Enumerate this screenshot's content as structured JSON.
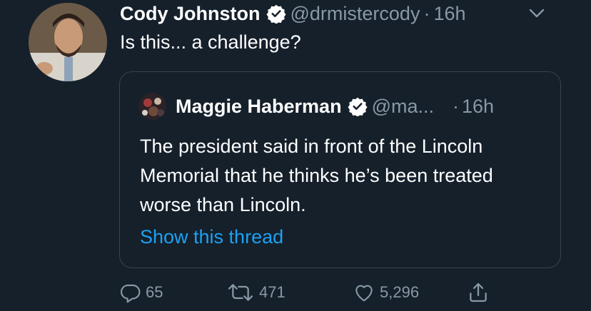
{
  "tweet": {
    "author_name": "Cody Johnston",
    "handle": "@drmistercody",
    "separator": "·",
    "time": "16h",
    "text": "Is this... a challenge?"
  },
  "quoted_tweet": {
    "author_name": "Maggie Haberman",
    "handle": "@ma...",
    "separator": "·",
    "time": "16h",
    "text": "The president said in front of the Lincoln Memorial that he thinks he’s been treated worse than Lincoln.",
    "link": "Show this thread"
  },
  "actions": {
    "replies": "65",
    "retweets": "471",
    "likes": "5,296"
  },
  "colors": {
    "background": "#15202b",
    "muted": "#8899a6",
    "accent": "#1da1f2",
    "border": "#38444d"
  },
  "icons": [
    "verified-badge-icon",
    "chevron-down-icon",
    "reply-icon",
    "retweet-icon",
    "like-icon",
    "share-icon"
  ]
}
